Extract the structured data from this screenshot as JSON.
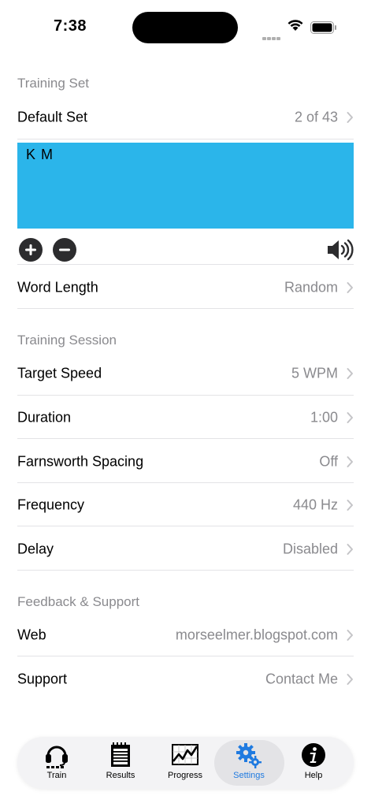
{
  "status": {
    "time": "7:38"
  },
  "sections": {
    "training_set": "Training Set",
    "training_session": "Training Session",
    "feedback": "Feedback & Support"
  },
  "rows": {
    "default_set": {
      "label": "Default Set",
      "value": "2 of 43"
    },
    "word_length": {
      "label": "Word Length",
      "value": "Random"
    },
    "target_speed": {
      "label": "Target Speed",
      "value": "5 WPM"
    },
    "duration": {
      "label": "Duration",
      "value": "1:00"
    },
    "farnsworth": {
      "label": "Farnsworth Spacing",
      "value": "Off"
    },
    "frequency": {
      "label": "Frequency",
      "value": "440 Hz"
    },
    "delay": {
      "label": "Delay",
      "value": "Disabled"
    },
    "web": {
      "label": "Web",
      "value": "morseelmer.blogspot.com"
    },
    "support": {
      "label": "Support",
      "value": "Contact Me"
    }
  },
  "charset": {
    "text": "K M",
    "background": "#2bb5ea"
  },
  "icons": {
    "add": "plus-circle-icon",
    "remove": "minus-circle-icon",
    "speaker": "speaker-wave-icon"
  },
  "tabs": [
    {
      "label": "Train",
      "icon": "headset-icon"
    },
    {
      "label": "Results",
      "icon": "notepad-icon"
    },
    {
      "label": "Progress",
      "icon": "chart-icon"
    },
    {
      "label": "Settings",
      "icon": "gear-icon",
      "active": true
    },
    {
      "label": "Help",
      "icon": "info-icon"
    }
  ],
  "colors": {
    "accent": "#1f7ae0",
    "secondary_text": "#8a8a8e"
  }
}
